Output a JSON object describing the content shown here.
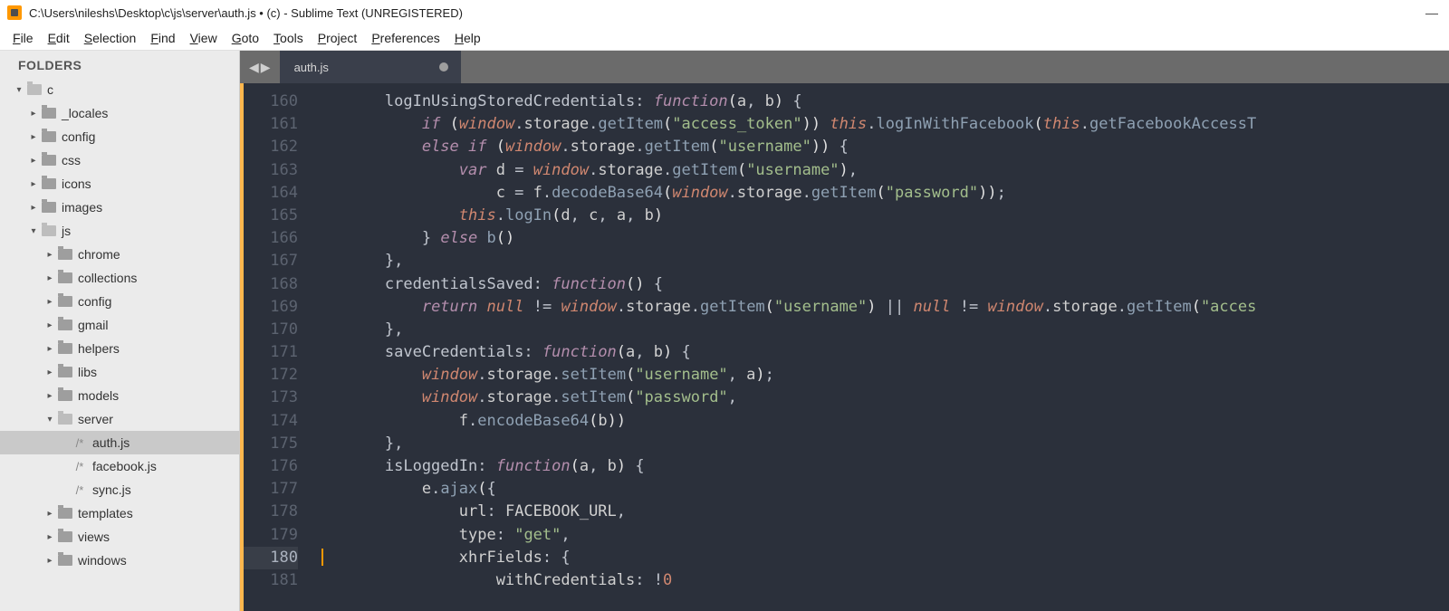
{
  "titlebar": {
    "title": "C:\\Users\\nileshs\\Desktop\\c\\js\\server\\auth.js • (c) - Sublime Text (UNREGISTERED)"
  },
  "menu": {
    "items": [
      "File",
      "Edit",
      "Selection",
      "Find",
      "View",
      "Goto",
      "Tools",
      "Project",
      "Preferences",
      "Help"
    ]
  },
  "sidebar": {
    "header": "FOLDERS",
    "tree": [
      {
        "indent": 0,
        "arrow": "down",
        "kind": "folder-open",
        "label": "c"
      },
      {
        "indent": 1,
        "arrow": "right",
        "kind": "folder",
        "label": "_locales"
      },
      {
        "indent": 1,
        "arrow": "right",
        "kind": "folder",
        "label": "config"
      },
      {
        "indent": 1,
        "arrow": "right",
        "kind": "folder",
        "label": "css"
      },
      {
        "indent": 1,
        "arrow": "right",
        "kind": "folder",
        "label": "icons"
      },
      {
        "indent": 1,
        "arrow": "right",
        "kind": "folder",
        "label": "images"
      },
      {
        "indent": 1,
        "arrow": "down",
        "kind": "folder-open",
        "label": "js"
      },
      {
        "indent": 2,
        "arrow": "right",
        "kind": "folder",
        "label": "chrome"
      },
      {
        "indent": 2,
        "arrow": "right",
        "kind": "folder",
        "label": "collections"
      },
      {
        "indent": 2,
        "arrow": "right",
        "kind": "folder",
        "label": "config"
      },
      {
        "indent": 2,
        "arrow": "right",
        "kind": "folder",
        "label": "gmail"
      },
      {
        "indent": 2,
        "arrow": "right",
        "kind": "folder",
        "label": "helpers"
      },
      {
        "indent": 2,
        "arrow": "right",
        "kind": "folder",
        "label": "libs"
      },
      {
        "indent": 2,
        "arrow": "right",
        "kind": "folder",
        "label": "models"
      },
      {
        "indent": 2,
        "arrow": "down",
        "kind": "folder-open",
        "label": "server"
      },
      {
        "indent": 3,
        "arrow": "blank",
        "kind": "file",
        "label": "auth.js",
        "sel": true
      },
      {
        "indent": 3,
        "arrow": "blank",
        "kind": "file",
        "label": "facebook.js"
      },
      {
        "indent": 3,
        "arrow": "blank",
        "kind": "file",
        "label": "sync.js"
      },
      {
        "indent": 2,
        "arrow": "right",
        "kind": "folder",
        "label": "templates"
      },
      {
        "indent": 2,
        "arrow": "right",
        "kind": "folder",
        "label": "views"
      },
      {
        "indent": 2,
        "arrow": "right",
        "kind": "folder",
        "label": "windows"
      }
    ]
  },
  "tabs": {
    "active": "auth.js",
    "dirty": true
  },
  "editor": {
    "first_line": 160,
    "current_line": 180,
    "lines": [
      [
        [
          "tk-prop",
          "        logInUsingStoredCredentials"
        ],
        [
          "tk-punct",
          ":"
        ],
        [
          "tk-var",
          " "
        ],
        [
          "tk-key",
          "function"
        ],
        [
          "tk-paren",
          "("
        ],
        [
          "tk-var",
          "a"
        ],
        [
          "tk-punct",
          ","
        ],
        [
          "tk-var",
          " b"
        ],
        [
          "tk-paren",
          ")"
        ],
        [
          "tk-var",
          " "
        ],
        [
          "tk-punct",
          "{"
        ]
      ],
      [
        [
          "tk-var",
          "            "
        ],
        [
          "tk-key",
          "if"
        ],
        [
          "tk-var",
          " "
        ],
        [
          "tk-paren",
          "("
        ],
        [
          "tk-builtin",
          "window"
        ],
        [
          "tk-punct",
          "."
        ],
        [
          "tk-var",
          "storage"
        ],
        [
          "tk-punct",
          "."
        ],
        [
          "tk-func",
          "getItem"
        ],
        [
          "tk-paren",
          "("
        ],
        [
          "tk-str",
          "\"access_token\""
        ],
        [
          "tk-paren",
          "))"
        ],
        [
          "tk-var",
          " "
        ],
        [
          "tk-this",
          "this"
        ],
        [
          "tk-punct",
          "."
        ],
        [
          "tk-func",
          "logInWithFacebook"
        ],
        [
          "tk-paren",
          "("
        ],
        [
          "tk-this",
          "this"
        ],
        [
          "tk-punct",
          "."
        ],
        [
          "tk-func",
          "getFacebookAccessT"
        ]
      ],
      [
        [
          "tk-var",
          "            "
        ],
        [
          "tk-key",
          "else if"
        ],
        [
          "tk-var",
          " "
        ],
        [
          "tk-paren",
          "("
        ],
        [
          "tk-builtin",
          "window"
        ],
        [
          "tk-punct",
          "."
        ],
        [
          "tk-var",
          "storage"
        ],
        [
          "tk-punct",
          "."
        ],
        [
          "tk-func",
          "getItem"
        ],
        [
          "tk-paren",
          "("
        ],
        [
          "tk-str",
          "\"username\""
        ],
        [
          "tk-paren",
          "))"
        ],
        [
          "tk-var",
          " "
        ],
        [
          "tk-punct",
          "{"
        ]
      ],
      [
        [
          "tk-var",
          "                "
        ],
        [
          "tk-key",
          "var"
        ],
        [
          "tk-var",
          " d "
        ],
        [
          "tk-op",
          "="
        ],
        [
          "tk-var",
          " "
        ],
        [
          "tk-builtin",
          "window"
        ],
        [
          "tk-punct",
          "."
        ],
        [
          "tk-var",
          "storage"
        ],
        [
          "tk-punct",
          "."
        ],
        [
          "tk-func",
          "getItem"
        ],
        [
          "tk-paren",
          "("
        ],
        [
          "tk-str",
          "\"username\""
        ],
        [
          "tk-paren",
          ")"
        ],
        [
          "tk-punct",
          ","
        ]
      ],
      [
        [
          "tk-var",
          "                    c "
        ],
        [
          "tk-op",
          "="
        ],
        [
          "tk-var",
          " f"
        ],
        [
          "tk-punct",
          "."
        ],
        [
          "tk-func",
          "decodeBase64"
        ],
        [
          "tk-paren",
          "("
        ],
        [
          "tk-builtin",
          "window"
        ],
        [
          "tk-punct",
          "."
        ],
        [
          "tk-var",
          "storage"
        ],
        [
          "tk-punct",
          "."
        ],
        [
          "tk-func",
          "getItem"
        ],
        [
          "tk-paren",
          "("
        ],
        [
          "tk-str",
          "\"password\""
        ],
        [
          "tk-paren",
          "))"
        ],
        [
          "tk-punct",
          ";"
        ]
      ],
      [
        [
          "tk-var",
          "                "
        ],
        [
          "tk-this",
          "this"
        ],
        [
          "tk-punct",
          "."
        ],
        [
          "tk-func",
          "logIn"
        ],
        [
          "tk-paren",
          "("
        ],
        [
          "tk-var",
          "d"
        ],
        [
          "tk-punct",
          ","
        ],
        [
          "tk-var",
          " c"
        ],
        [
          "tk-punct",
          ","
        ],
        [
          "tk-var",
          " a"
        ],
        [
          "tk-punct",
          ","
        ],
        [
          "tk-var",
          " b"
        ],
        [
          "tk-paren",
          ")"
        ]
      ],
      [
        [
          "tk-var",
          "            "
        ],
        [
          "tk-punct",
          "}"
        ],
        [
          "tk-var",
          " "
        ],
        [
          "tk-key",
          "else"
        ],
        [
          "tk-var",
          " "
        ],
        [
          "tk-func",
          "b"
        ],
        [
          "tk-paren",
          "()"
        ]
      ],
      [
        [
          "tk-var",
          "        "
        ],
        [
          "tk-punct",
          "},"
        ]
      ],
      [
        [
          "tk-prop",
          "        credentialsSaved"
        ],
        [
          "tk-punct",
          ":"
        ],
        [
          "tk-var",
          " "
        ],
        [
          "tk-key",
          "function"
        ],
        [
          "tk-paren",
          "()"
        ],
        [
          "tk-var",
          " "
        ],
        [
          "tk-punct",
          "{"
        ]
      ],
      [
        [
          "tk-var",
          "            "
        ],
        [
          "tk-key",
          "return"
        ],
        [
          "tk-var",
          " "
        ],
        [
          "tk-null",
          "null"
        ],
        [
          "tk-var",
          " "
        ],
        [
          "tk-op",
          "!="
        ],
        [
          "tk-var",
          " "
        ],
        [
          "tk-builtin",
          "window"
        ],
        [
          "tk-punct",
          "."
        ],
        [
          "tk-var",
          "storage"
        ],
        [
          "tk-punct",
          "."
        ],
        [
          "tk-func",
          "getItem"
        ],
        [
          "tk-paren",
          "("
        ],
        [
          "tk-str",
          "\"username\""
        ],
        [
          "tk-paren",
          ")"
        ],
        [
          "tk-var",
          " "
        ],
        [
          "tk-op",
          "||"
        ],
        [
          "tk-var",
          " "
        ],
        [
          "tk-null",
          "null"
        ],
        [
          "tk-var",
          " "
        ],
        [
          "tk-op",
          "!="
        ],
        [
          "tk-var",
          " "
        ],
        [
          "tk-builtin",
          "window"
        ],
        [
          "tk-punct",
          "."
        ],
        [
          "tk-var",
          "storage"
        ],
        [
          "tk-punct",
          "."
        ],
        [
          "tk-func",
          "getItem"
        ],
        [
          "tk-paren",
          "("
        ],
        [
          "tk-str",
          "\"acces"
        ]
      ],
      [
        [
          "tk-var",
          "        "
        ],
        [
          "tk-punct",
          "},"
        ]
      ],
      [
        [
          "tk-prop",
          "        saveCredentials"
        ],
        [
          "tk-punct",
          ":"
        ],
        [
          "tk-var",
          " "
        ],
        [
          "tk-key",
          "function"
        ],
        [
          "tk-paren",
          "("
        ],
        [
          "tk-var",
          "a"
        ],
        [
          "tk-punct",
          ","
        ],
        [
          "tk-var",
          " b"
        ],
        [
          "tk-paren",
          ")"
        ],
        [
          "tk-var",
          " "
        ],
        [
          "tk-punct",
          "{"
        ]
      ],
      [
        [
          "tk-var",
          "            "
        ],
        [
          "tk-builtin",
          "window"
        ],
        [
          "tk-punct",
          "."
        ],
        [
          "tk-var",
          "storage"
        ],
        [
          "tk-punct",
          "."
        ],
        [
          "tk-func",
          "setItem"
        ],
        [
          "tk-paren",
          "("
        ],
        [
          "tk-str",
          "\"username\""
        ],
        [
          "tk-punct",
          ","
        ],
        [
          "tk-var",
          " a"
        ],
        [
          "tk-paren",
          ")"
        ],
        [
          "tk-punct",
          ";"
        ]
      ],
      [
        [
          "tk-var",
          "            "
        ],
        [
          "tk-builtin",
          "window"
        ],
        [
          "tk-punct",
          "."
        ],
        [
          "tk-var",
          "storage"
        ],
        [
          "tk-punct",
          "."
        ],
        [
          "tk-func",
          "setItem"
        ],
        [
          "tk-paren",
          "("
        ],
        [
          "tk-str",
          "\"password\""
        ],
        [
          "tk-punct",
          ","
        ]
      ],
      [
        [
          "tk-var",
          "                f"
        ],
        [
          "tk-punct",
          "."
        ],
        [
          "tk-func",
          "encodeBase64"
        ],
        [
          "tk-paren",
          "("
        ],
        [
          "tk-var",
          "b"
        ],
        [
          "tk-paren",
          "))"
        ]
      ],
      [
        [
          "tk-var",
          "        "
        ],
        [
          "tk-punct",
          "},"
        ]
      ],
      [
        [
          "tk-prop",
          "        isLoggedIn"
        ],
        [
          "tk-punct",
          ":"
        ],
        [
          "tk-var",
          " "
        ],
        [
          "tk-key",
          "function"
        ],
        [
          "tk-paren",
          "("
        ],
        [
          "tk-var",
          "a"
        ],
        [
          "tk-punct",
          ","
        ],
        [
          "tk-var",
          " b"
        ],
        [
          "tk-paren",
          ")"
        ],
        [
          "tk-var",
          " "
        ],
        [
          "tk-punct",
          "{"
        ]
      ],
      [
        [
          "tk-var",
          "            e"
        ],
        [
          "tk-punct",
          "."
        ],
        [
          "tk-func",
          "ajax"
        ],
        [
          "tk-paren",
          "("
        ],
        [
          "tk-punct",
          "{"
        ]
      ],
      [
        [
          "tk-var",
          "                url"
        ],
        [
          "tk-punct",
          ":"
        ],
        [
          "tk-var",
          " FACEBOOK_URL"
        ],
        [
          "tk-punct",
          ","
        ]
      ],
      [
        [
          "tk-var",
          "                type"
        ],
        [
          "tk-punct",
          ":"
        ],
        [
          "tk-var",
          " "
        ],
        [
          "tk-str",
          "\"get\""
        ],
        [
          "tk-punct",
          ","
        ]
      ],
      [
        [
          "tk-var",
          "                xhrFields"
        ],
        [
          "tk-punct",
          ":"
        ],
        [
          "tk-var",
          " "
        ],
        [
          "tk-punct",
          "{"
        ]
      ],
      [
        [
          "tk-var",
          "                    withCredentials"
        ],
        [
          "tk-punct",
          ":"
        ],
        [
          "tk-var",
          " "
        ],
        [
          "tk-op",
          "!"
        ],
        [
          "tk-num",
          "0"
        ]
      ]
    ]
  }
}
